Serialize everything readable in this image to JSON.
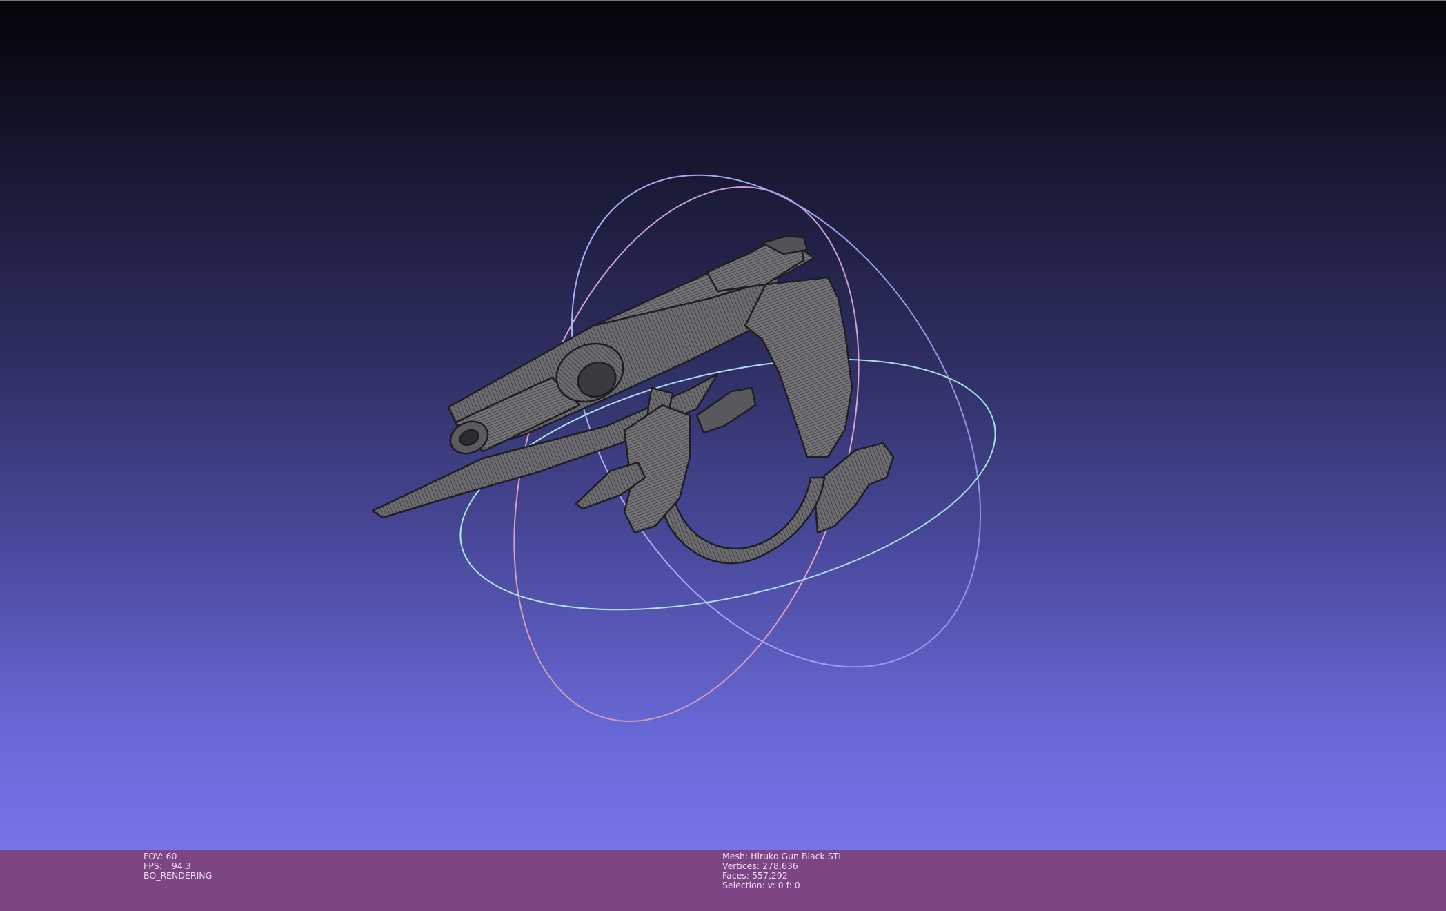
{
  "viewer": {
    "background_top": "#040408",
    "background_bottom": "#7575ea",
    "status_bar_color": "#7e4585"
  },
  "left_info": {
    "fov_label": "FOV: 60",
    "fps_label": "FPS:",
    "fps_value": "94.3",
    "render_mode": "BO_RENDERING"
  },
  "mesh_info": {
    "mesh": "Mesh: Hiruko Gun Black.STL",
    "vertices": "Vertices: 278,636",
    "faces": "Faces: 557,292",
    "selection": "Selection: v: 0 f: 0"
  },
  "trackball": {
    "ring_colors": [
      "#e7a3c8",
      "#a9a9ff",
      "#9fe2d6"
    ]
  },
  "model": {
    "name": "hiruko-gun-mesh",
    "fill": "#5f5f63",
    "wire": "#2a2a2e"
  }
}
